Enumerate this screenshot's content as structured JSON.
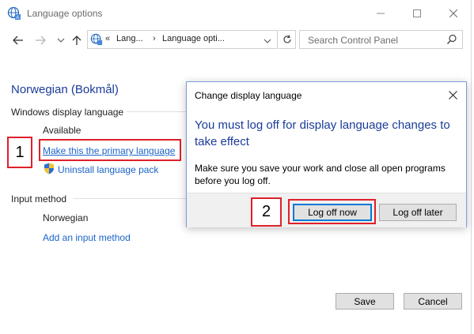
{
  "window": {
    "title": "Language options",
    "icons": {
      "app": "language-globe-icon",
      "minimize": "minimize-icon",
      "maximize": "maximize-icon",
      "close": "close-icon"
    }
  },
  "nav": {
    "address": {
      "chevron": "«",
      "crumb1": "Lang...",
      "separator": "›",
      "crumb2": "Language opti..."
    },
    "search_placeholder": "Search Control Panel"
  },
  "content": {
    "heading": "Norwegian (Bokmål)",
    "display_section": "Windows display language",
    "available": "Available",
    "primary_link": "Make this the primary language",
    "uninstall_link": "Uninstall language pack",
    "input_section": "Input method",
    "input_language": "Norwegian",
    "add_input_link": "Add an input method"
  },
  "footer": {
    "save": "Save",
    "cancel": "Cancel"
  },
  "dialog": {
    "title": "Change display language",
    "heading": "You must log off for display language changes to take effect",
    "body": "Make sure you save your work and close all open programs before you log off.",
    "buttons": {
      "log_off_now": "Log off now",
      "log_off_later": "Log off later"
    }
  },
  "annotations": {
    "step1": "1",
    "step2": "2"
  },
  "colors": {
    "heading_blue": "#1a3c9a",
    "link_blue": "#1a64c8",
    "highlight_red": "#e0202a",
    "accent": "#0078d7"
  }
}
